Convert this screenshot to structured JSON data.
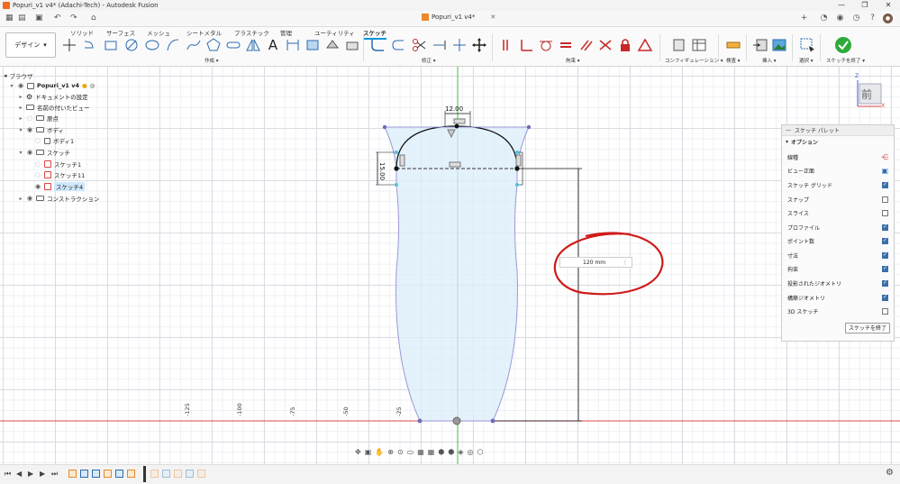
{
  "window": {
    "title": "Popuri_v1 v4* (Adachi-Tech) - Autodesk Fusion",
    "controls": [
      "—",
      "❐",
      "✕"
    ]
  },
  "doc_tab": {
    "name": "Popuri_v1 v4*",
    "close": "✕"
  },
  "ribbon": {
    "design_button": "デザイン",
    "tabs": [
      "ソリッド",
      "サーフェス",
      "メッシュ",
      "シートメタル",
      "プラスチック",
      "管理",
      "ユーティリティ",
      "スケッチ"
    ],
    "active_tab": "スケッチ",
    "groups": [
      "作成",
      "修正",
      "拘束",
      "コンフィギュレーション",
      "検査",
      "挿入",
      "選択",
      "スケッチを終了"
    ]
  },
  "browser": {
    "header": "ブラウザ",
    "items": [
      {
        "label": "Popuri_v1 v4"
      },
      {
        "label": "ドキュメントの設定"
      },
      {
        "label": "名前の付いたビュー"
      },
      {
        "label": "原点"
      },
      {
        "label": "ボディ"
      },
      {
        "label": "ボディ1"
      },
      {
        "label": "スケッチ"
      },
      {
        "label": "スケッチ1"
      },
      {
        "label": "スケッチ11"
      },
      {
        "label": "スケッチ4"
      },
      {
        "label": "コンストラクション"
      }
    ]
  },
  "palette": {
    "title": "スケッチ パレット",
    "section": "オプション",
    "rows": [
      {
        "label": "線種",
        "kind": "icon"
      },
      {
        "label": "ビュー正面",
        "kind": "icon"
      },
      {
        "label": "スケッチ グリッド",
        "checked": true
      },
      {
        "label": "スナップ",
        "checked": false
      },
      {
        "label": "スライス",
        "checked": false
      },
      {
        "label": "プロファイル",
        "checked": true
      },
      {
        "label": "ポイント数",
        "checked": true
      },
      {
        "label": "寸法",
        "checked": true
      },
      {
        "label": "拘束",
        "checked": true
      },
      {
        "label": "投影されたジオメトリ",
        "checked": true
      },
      {
        "label": "構築ジオメトリ",
        "checked": true
      },
      {
        "label": "3D スケッチ",
        "checked": false
      }
    ],
    "finish_button": "スケッチを終了"
  },
  "viewcube": {
    "face": "前",
    "axis_z": "Z",
    "axis_x": "X"
  },
  "sketch": {
    "dim_top": "12.00",
    "dim_side": "15.00",
    "dim_input_value": "120 mm",
    "axis_ticks": [
      "-125",
      "-100",
      "-75",
      "-50",
      "-25"
    ]
  },
  "colors": {
    "accent": "#0696d7",
    "profile_fill": "#dbeefb",
    "sketch_line": "#9b98d6",
    "annotation_red": "#d11a1a",
    "axis_green": "#3fbf3f",
    "axis_red": "#e04848"
  }
}
